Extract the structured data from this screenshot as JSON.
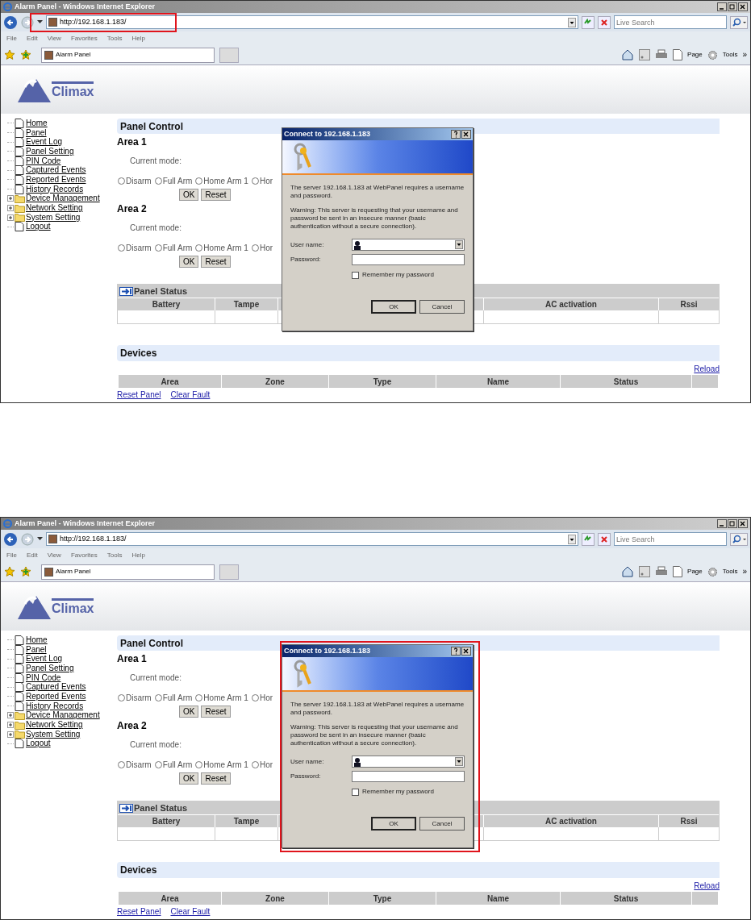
{
  "screenshots": [
    {
      "address_bar_highlighted": true,
      "window": {
        "title": "Alarm Panel - Windows Internet Explorer"
      },
      "address": "http://192.168.1.183/",
      "search": {
        "placeholder": "Live Search"
      },
      "menu": [
        "File",
        "Edit",
        "View",
        "Favorites",
        "Tools",
        "Help"
      ],
      "tab": {
        "label": "Alarm Panel"
      },
      "toolbar": [
        "Page",
        "Tools",
        "»"
      ],
      "logo_text": "Climax",
      "sidebar": [
        {
          "label": "Home",
          "kind": "page"
        },
        {
          "label": "Panel",
          "kind": "page"
        },
        {
          "label": "Event Log",
          "kind": "page"
        },
        {
          "label": "Panel Setting",
          "kind": "page"
        },
        {
          "label": "PIN Code",
          "kind": "page"
        },
        {
          "label": "Captured Events",
          "kind": "page"
        },
        {
          "label": "Reported Events",
          "kind": "page"
        },
        {
          "label": "History Records",
          "kind": "page"
        },
        {
          "label": "Device Management",
          "kind": "folder"
        },
        {
          "label": "Network Setting",
          "kind": "folder"
        },
        {
          "label": "System Setting",
          "kind": "folder"
        },
        {
          "label": "Logout",
          "kind": "page"
        }
      ],
      "panel_control": {
        "title": "Panel Control",
        "areas": [
          {
            "title": "Area 1",
            "mode_label": "Current mode:",
            "modes": [
              {
                "label": "Disarm",
                "selected": false
              },
              {
                "label": "Full Arm",
                "selected": false
              },
              {
                "label": "Home Arm 1",
                "selected": false
              },
              {
                "label": "Hor",
                "selected": false
              }
            ],
            "buttons": [
              "OK",
              "Reset"
            ]
          },
          {
            "title": "Area 2",
            "mode_label": "Current mode:",
            "modes": [
              {
                "label": "Disarm",
                "selected": false
              },
              {
                "label": "Full Arm",
                "selected": false
              },
              {
                "label": "Home Arm 1",
                "selected": false
              },
              {
                "label": "Hor",
                "selected": false
              }
            ],
            "buttons": [
              "OK",
              "Reset"
            ]
          }
        ]
      },
      "panel_status": {
        "title": "Panel Status",
        "columns": [
          "Battery",
          "Tampe",
          "AC activation",
          "Rssi"
        ]
      },
      "devices": {
        "title": "Devices",
        "reload": "Reload",
        "columns": [
          "Area",
          "Zone",
          "Type",
          "Name",
          "Status"
        ],
        "links": [
          "Reset Panel",
          "Clear Fault"
        ]
      },
      "dialog": {
        "title": "Connect to 192.168.1.183",
        "message": "The server 192.168.1.183 at WebPanel requires a username and password.",
        "warning": "Warning: This server is requesting that your username and password be sent in an insecure manner (basic authentication without a secure connection).",
        "username_label": "User name:",
        "password_label": "Password:",
        "remember": {
          "label": "Remember my password",
          "checked": false
        },
        "buttons": [
          "OK",
          "Cancel"
        ]
      }
    },
    {
      "dialog_highlighted": true,
      "window": {
        "title": "Alarm Panel - Windows Internet Explorer"
      },
      "address": "http://192.168.1.183/",
      "search": {
        "placeholder": "Live Search"
      },
      "menu": [
        "File",
        "Edit",
        "View",
        "Favorites",
        "Tools",
        "Help"
      ],
      "tab": {
        "label": "Alarm Panel"
      },
      "toolbar": [
        "Page",
        "Tools",
        "»"
      ],
      "logo_text": "Climax",
      "sidebar": [
        {
          "label": "Home",
          "kind": "page"
        },
        {
          "label": "Panel",
          "kind": "page"
        },
        {
          "label": "Event Log",
          "kind": "page"
        },
        {
          "label": "Panel Setting",
          "kind": "page"
        },
        {
          "label": "PIN Code",
          "kind": "page"
        },
        {
          "label": "Captured Events",
          "kind": "page"
        },
        {
          "label": "Reported Events",
          "kind": "page"
        },
        {
          "label": "History Records",
          "kind": "page"
        },
        {
          "label": "Device Management",
          "kind": "folder"
        },
        {
          "label": "Network Setting",
          "kind": "folder"
        },
        {
          "label": "System Setting",
          "kind": "folder"
        },
        {
          "label": "Logout",
          "kind": "page"
        }
      ],
      "panel_control": {
        "title": "Panel Control",
        "areas": [
          {
            "title": "Area 1",
            "mode_label": "Current mode:",
            "modes": [
              {
                "label": "Disarm",
                "selected": false
              },
              {
                "label": "Full Arm",
                "selected": false
              },
              {
                "label": "Home Arm 1",
                "selected": false
              },
              {
                "label": "Hor",
                "selected": false
              }
            ],
            "buttons": [
              "OK",
              "Reset"
            ]
          },
          {
            "title": "Area 2",
            "mode_label": "Current mode:",
            "modes": [
              {
                "label": "Disarm",
                "selected": false
              },
              {
                "label": "Full Arm",
                "selected": false
              },
              {
                "label": "Home Arm 1",
                "selected": false
              },
              {
                "label": "Hor",
                "selected": false
              }
            ],
            "buttons": [
              "OK",
              "Reset"
            ]
          }
        ]
      },
      "panel_status": {
        "title": "Panel Status",
        "columns": [
          "Battery",
          "Tampe",
          "AC activation",
          "Rssi"
        ]
      },
      "devices": {
        "title": "Devices",
        "reload": "Reload",
        "columns": [
          "Area",
          "Zone",
          "Type",
          "Name",
          "Status"
        ],
        "links": [
          "Reset Panel",
          "Clear Fault"
        ]
      },
      "dialog": {
        "title": "Connect to 192.168.1.183",
        "message": "The server 192.168.1.183 at WebPanel requires a username and password.",
        "warning": "Warning: This server is requesting that your username and password be sent in an insecure manner (basic authentication without a secure connection).",
        "username_label": "User name:",
        "password_label": "Password:",
        "remember": {
          "label": "Remember my password",
          "checked": false
        },
        "buttons": [
          "OK",
          "Cancel"
        ]
      }
    }
  ]
}
